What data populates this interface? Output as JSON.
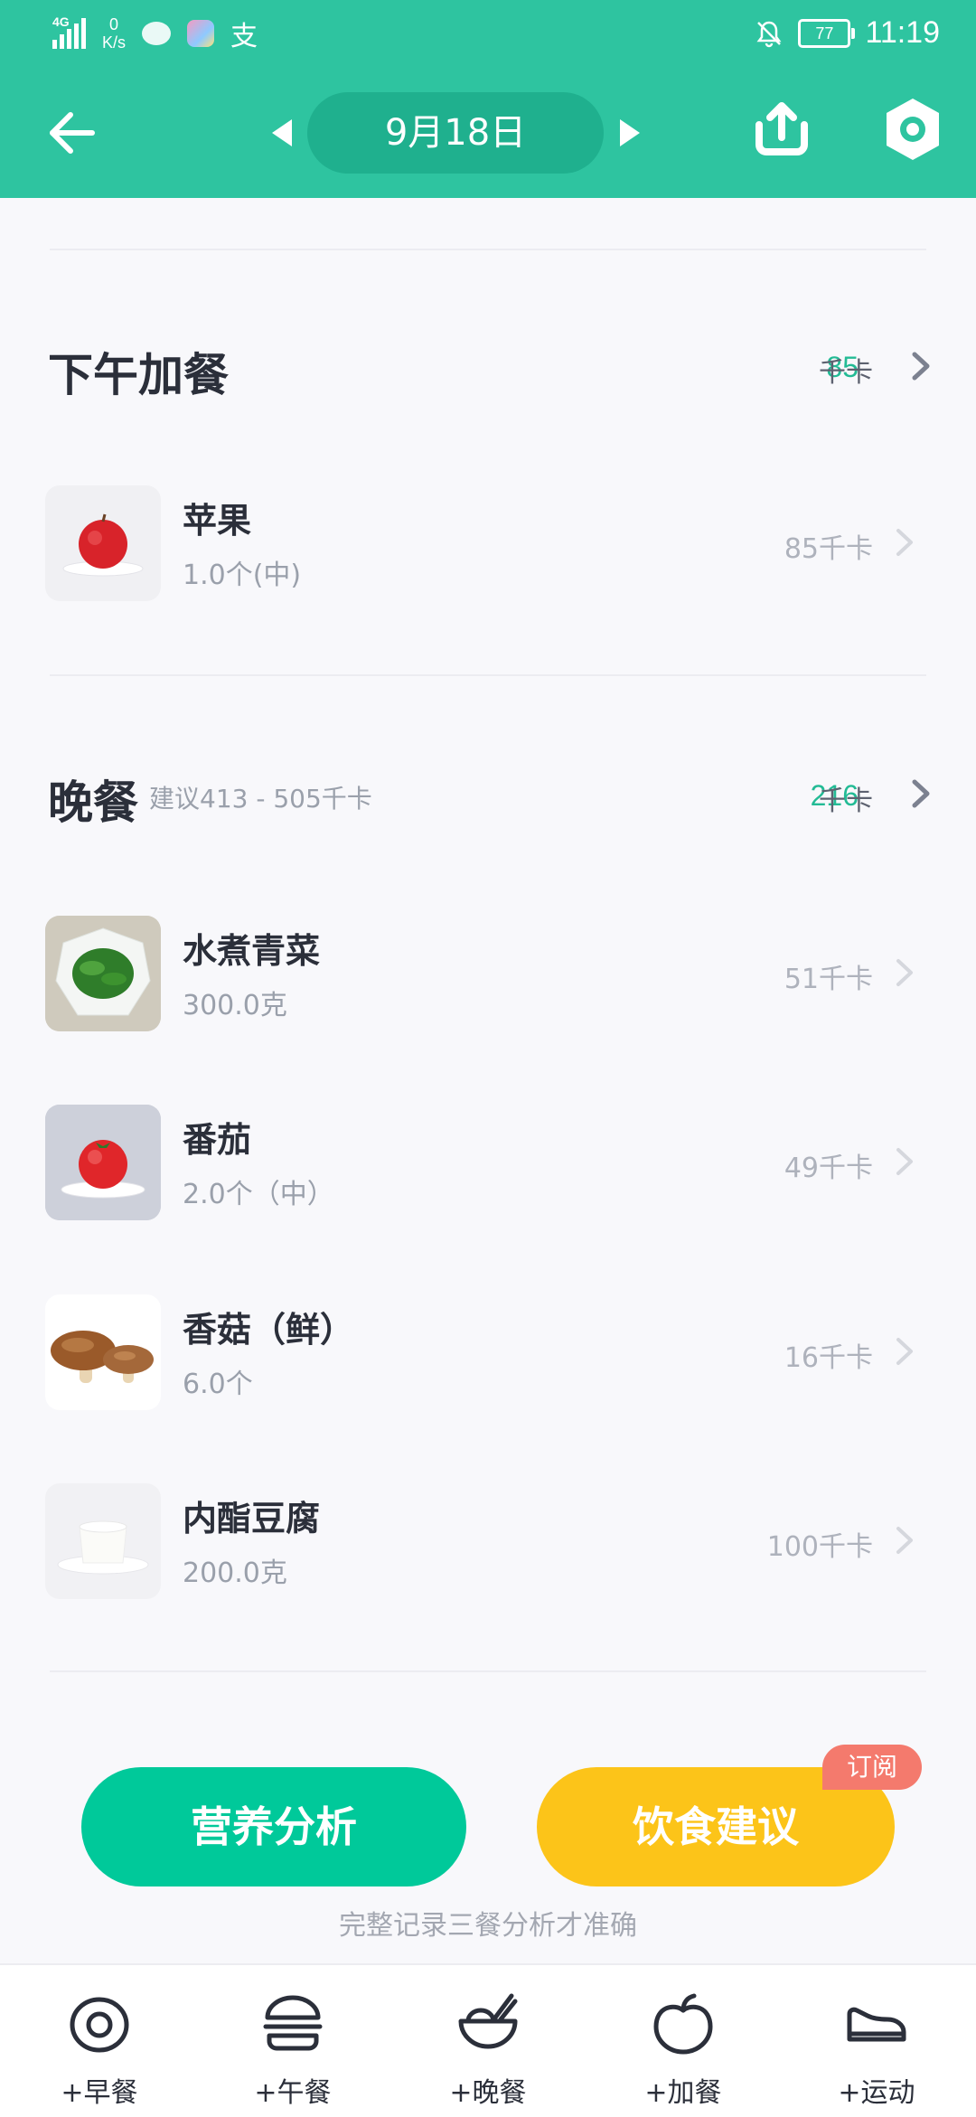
{
  "status_bar": {
    "network": "4G",
    "speed_value": "0",
    "speed_unit": "K/s",
    "alipay_glyph": "支",
    "battery": "77",
    "time": "11:19"
  },
  "nav": {
    "back_icon": "arrow-left-icon",
    "prev_icon": "caret-left-icon",
    "date": "9月18日",
    "next_icon": "caret-right-icon",
    "share_icon": "upload-icon",
    "settings_icon": "hexagon-gear-icon"
  },
  "meals": [
    {
      "title": "下午加餐",
      "hint": "",
      "kcal": "85",
      "unit": "千卡",
      "items": [
        {
          "name": "苹果",
          "amount": "1.0个(中)",
          "kcal": "85千卡",
          "image": "apple"
        }
      ]
    },
    {
      "title": "晚餐",
      "hint": "建议413 - 505千卡",
      "kcal": "216",
      "unit": "千卡",
      "items": [
        {
          "name": "水煮青菜",
          "amount": "300.0克",
          "kcal": "51千卡",
          "image": "boiled-greens"
        },
        {
          "name": "番茄",
          "amount": "2.0个（中）",
          "kcal": "49千卡",
          "image": "tomato"
        },
        {
          "name": "香菇（鲜）",
          "amount": "6.0个",
          "kcal": "16千卡",
          "image": "shiitake"
        },
        {
          "name": "内酯豆腐",
          "amount": "200.0克",
          "kcal": "100千卡",
          "image": "tofu"
        }
      ]
    }
  ],
  "actions": {
    "analysis": "营养分析",
    "advice": "饮食建议",
    "subscribe_badge": "订阅",
    "tip": "完整记录三餐分析才准确"
  },
  "tabs": [
    {
      "label": "+早餐",
      "icon": "egg-icon"
    },
    {
      "label": "+午餐",
      "icon": "burger-icon"
    },
    {
      "label": "+晚餐",
      "icon": "bowl-icon"
    },
    {
      "label": "+加餐",
      "icon": "apple-icon"
    },
    {
      "label": "+运动",
      "icon": "sneaker-icon"
    }
  ],
  "colors": {
    "header": "#2ec4a0",
    "accent_green": "#00c99a",
    "accent_yellow": "#fcc419",
    "badge_red": "#f47a6d"
  }
}
